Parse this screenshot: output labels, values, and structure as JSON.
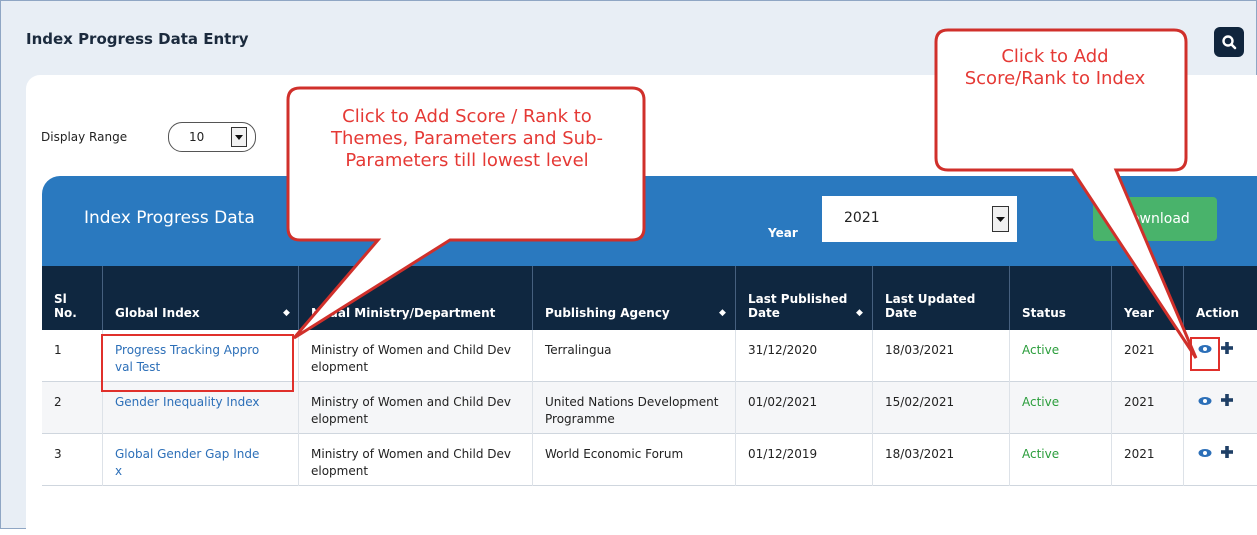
{
  "page": {
    "title": "Index Progress Data Entry"
  },
  "display_range": {
    "label": "Display Range",
    "value": "10"
  },
  "card": {
    "title": "Index Progress Data",
    "year_label": "Year",
    "year_value": "2021",
    "download_label": "Download"
  },
  "table": {
    "headers": {
      "sl": "Sl No.",
      "global_index": "Global Index",
      "ministry": "Nodal Ministry/Department",
      "agency": "Publishing Agency",
      "last_published": "Last Published Date",
      "last_updated": "Last Updated Date",
      "status": "Status",
      "year": "Year",
      "action": "Action"
    },
    "rows": [
      {
        "sl": "1",
        "index": "Progress Tracking Approval Test",
        "ministry": "Ministry of Women and Child Development",
        "agency": "Terralingua",
        "published": "31/12/2020",
        "updated": "18/03/2021",
        "status": "Active",
        "year": "2021"
      },
      {
        "sl": "2",
        "index": "Gender Inequality Index",
        "ministry": "Ministry of Women and Child Development",
        "agency": "United Nations Development Programme",
        "published": "01/02/2021",
        "updated": "15/02/2021",
        "status": "Active",
        "year": "2021"
      },
      {
        "sl": "3",
        "index": "Global Gender Gap Index",
        "ministry": "Ministry of Women and Child Development",
        "agency": "World Economic Forum",
        "published": "01/12/2019",
        "updated": "18/03/2021",
        "status": "Active",
        "year": "2021"
      }
    ]
  },
  "callouts": {
    "left": "Click to Add Score / Rank to Themes, Parameters and Sub-Parameters till lowest level",
    "right": "Click to Add Score/Rank to Index"
  },
  "colors": {
    "header_bg": "#0f2740",
    "card_bg": "#2a79bf",
    "download_bg": "#49b36b",
    "link": "#2c6fb8",
    "active": "#2a9d3b",
    "annotation": "#e53935"
  }
}
